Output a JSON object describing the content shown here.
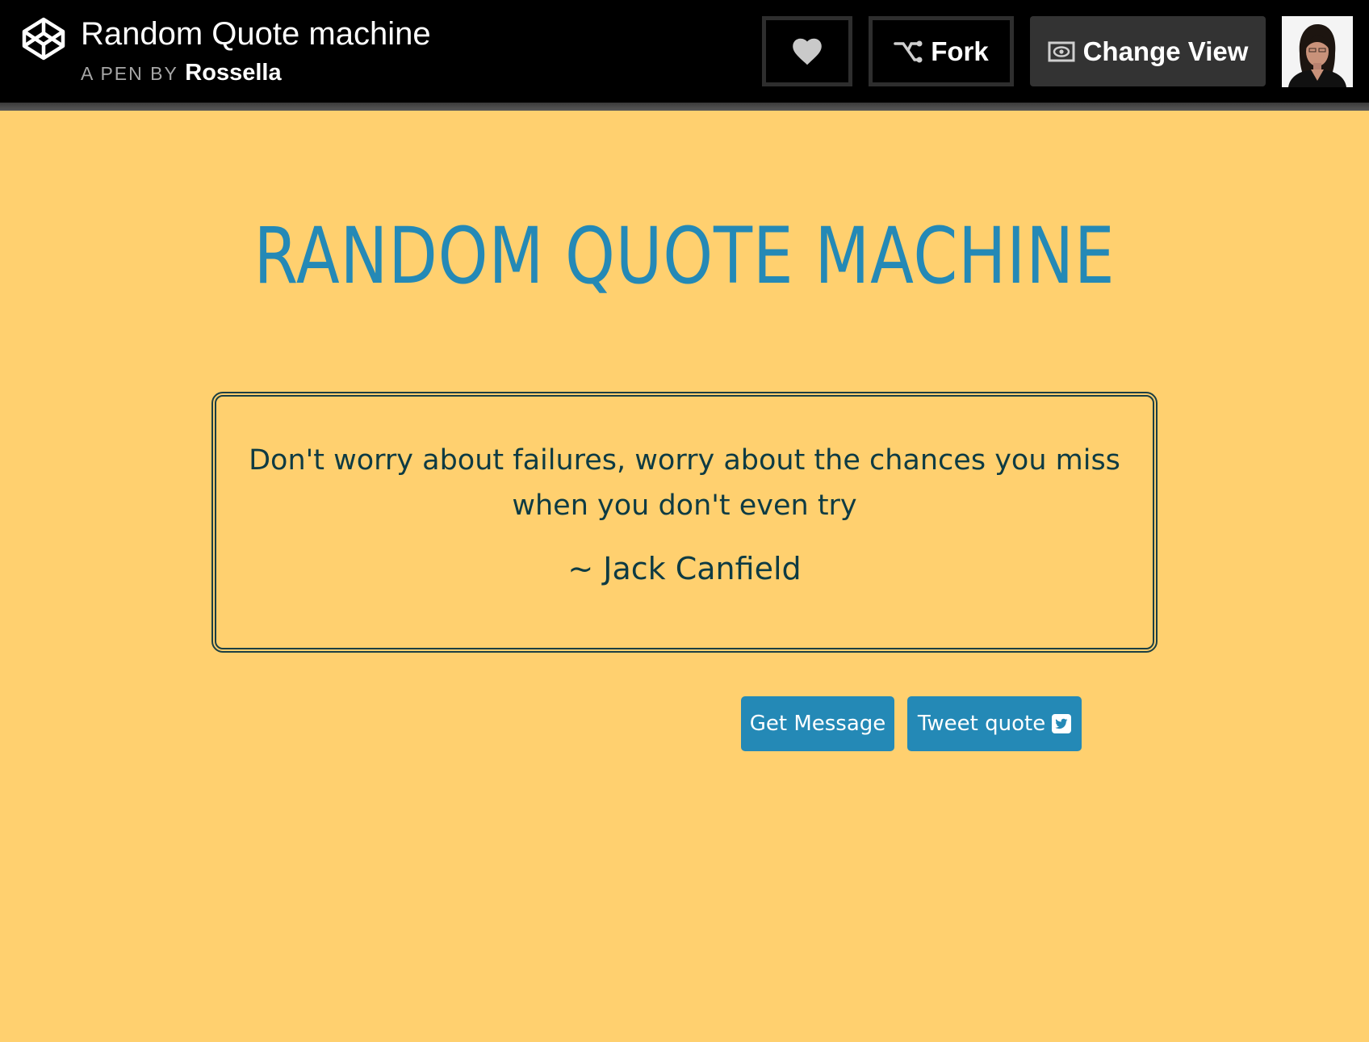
{
  "header": {
    "pen_title": "Random Quote machine",
    "byline_prefix": "A PEN BY",
    "author": "Rossella",
    "buttons": {
      "fork_label": "Fork",
      "change_view_label": "Change View"
    },
    "icons": {
      "logo": "codepen-logo-icon",
      "like": "heart-icon",
      "fork": "fork-icon",
      "view": "eye-icon"
    }
  },
  "main": {
    "title": "RANDOM QUOTE MACHINE",
    "quote": {
      "text": "Don't worry about failures, worry about the chances you miss when you don't even try",
      "author": "~ Jack Canfield"
    },
    "buttons": {
      "get_message_label": "Get Message",
      "tweet_label": "Tweet quote"
    }
  },
  "colors": {
    "background": "#FFD06F",
    "header_bg": "#000000",
    "accent": "#2489B6",
    "quote_text": "#0E3B43"
  }
}
